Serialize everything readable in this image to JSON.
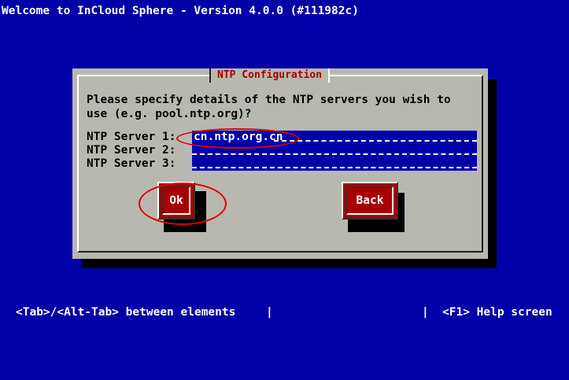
{
  "header": {
    "title": "Welcome to InCloud Sphere - Version 4.0.0 (#111982c)"
  },
  "dialog": {
    "title": "NTP Configuration",
    "prompt_line1": "Please specify details of the NTP servers you wish to",
    "prompt_line2": "use (e.g. pool.ntp.org)?"
  },
  "ntp_servers": [
    {
      "label": "NTP Server 1:",
      "value": "cn.ntp.org.cn"
    },
    {
      "label": "NTP Server 2:",
      "value": ""
    },
    {
      "label": "NTP Server 3:",
      "value": ""
    }
  ],
  "buttons": {
    "ok_label": "Ok",
    "back_label": "Back"
  },
  "status_bar": {
    "left": "<Tab>/<Alt-Tab> between elements",
    "separator": "|",
    "right": "<F1> Help screen"
  },
  "colors": {
    "background": "#0000a8",
    "dialog": "#b8b8b0",
    "accent": "#a80000",
    "annotation": "#e00000"
  }
}
